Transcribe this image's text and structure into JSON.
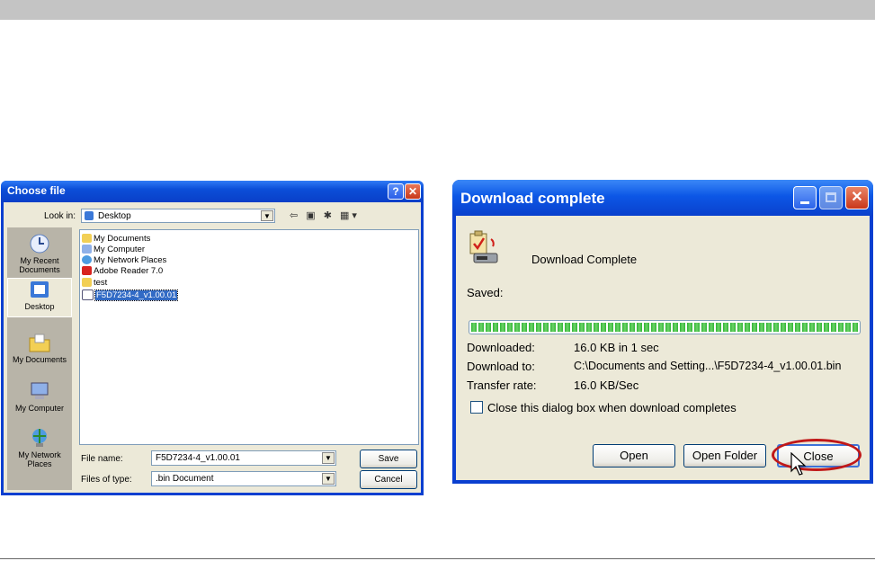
{
  "choose_file": {
    "title": "Choose file",
    "help_btn": "?",
    "close_btn": "✕",
    "look_in_label": "Look in:",
    "look_in_value": "Desktop",
    "places": [
      {
        "label": "My Recent Documents"
      },
      {
        "label": "Desktop"
      },
      {
        "label": "My Documents"
      },
      {
        "label": "My Computer"
      },
      {
        "label": "My Network Places"
      }
    ],
    "files": [
      {
        "name": "My Documents",
        "icon": "folder-documents-icon"
      },
      {
        "name": "My Computer",
        "icon": "computer-icon"
      },
      {
        "name": "My Network Places",
        "icon": "network-icon"
      },
      {
        "name": "Adobe Reader 7.0",
        "icon": "adobe-icon"
      },
      {
        "name": "test",
        "icon": "folder-icon"
      },
      {
        "name": "F5D7234-4_v1.00.01",
        "icon": "file-icon"
      }
    ],
    "file_name_label": "File name:",
    "file_name_value": "F5D7234-4_v1.00.01",
    "files_of_type_label": "Files of type:",
    "files_of_type_value": ".bin Document",
    "save_label": "Save",
    "cancel_label": "Cancel",
    "toolbar_icons": "⇦ ▣ ✱ ▦▾"
  },
  "download": {
    "title": "Download complete",
    "heading": "Download Complete",
    "saved_label": "Saved:",
    "progress": 1.0,
    "downloaded_label": "Downloaded:",
    "downloaded_value": "16.0 KB in 1 sec",
    "download_to_label": "Download to:",
    "download_to_value": "C:\\Documents and Setting...\\F5D7234-4_v1.00.01.bin",
    "transfer_rate_label": "Transfer rate:",
    "transfer_rate_value": "16.0 KB/Sec",
    "close_checkbox_label": "Close this dialog box when download completes",
    "open_label": "Open",
    "open_folder_label": "Open Folder",
    "close_label": "Close"
  },
  "colors": {
    "xp_title_blue": "#0b4ed8",
    "dialog_face": "#ece9d8",
    "selection_blue": "#316ac5",
    "progress_green": "#2fb534",
    "highlight_red": "#c01818"
  }
}
